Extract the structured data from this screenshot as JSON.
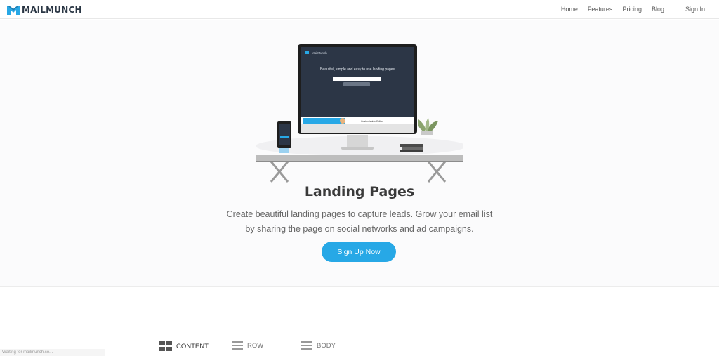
{
  "header": {
    "brand": "MAILMUNCH",
    "nav": [
      "Home",
      "Features",
      "Pricing",
      "Blog"
    ],
    "signin": "Sign In"
  },
  "hero": {
    "screen_brand": "MailMunch",
    "screen_headline": "Beautiful, simple and easy to use landing pages",
    "screen_feature": "Customizable Editor",
    "title": "Landing Pages",
    "subtitle_line1": "Create beautiful landing pages to capture leads. Grow your email list",
    "subtitle_line2": "by sharing the page on social networks and ad campaigns.",
    "cta": "Sign Up Now"
  },
  "tabs": {
    "content": "CONTENT",
    "row": "ROW",
    "body": "BODY"
  },
  "status_bar": "Waiting for mailmunch.co...",
  "colors": {
    "accent": "#27a8e6",
    "brand_dark": "#2a3644"
  }
}
